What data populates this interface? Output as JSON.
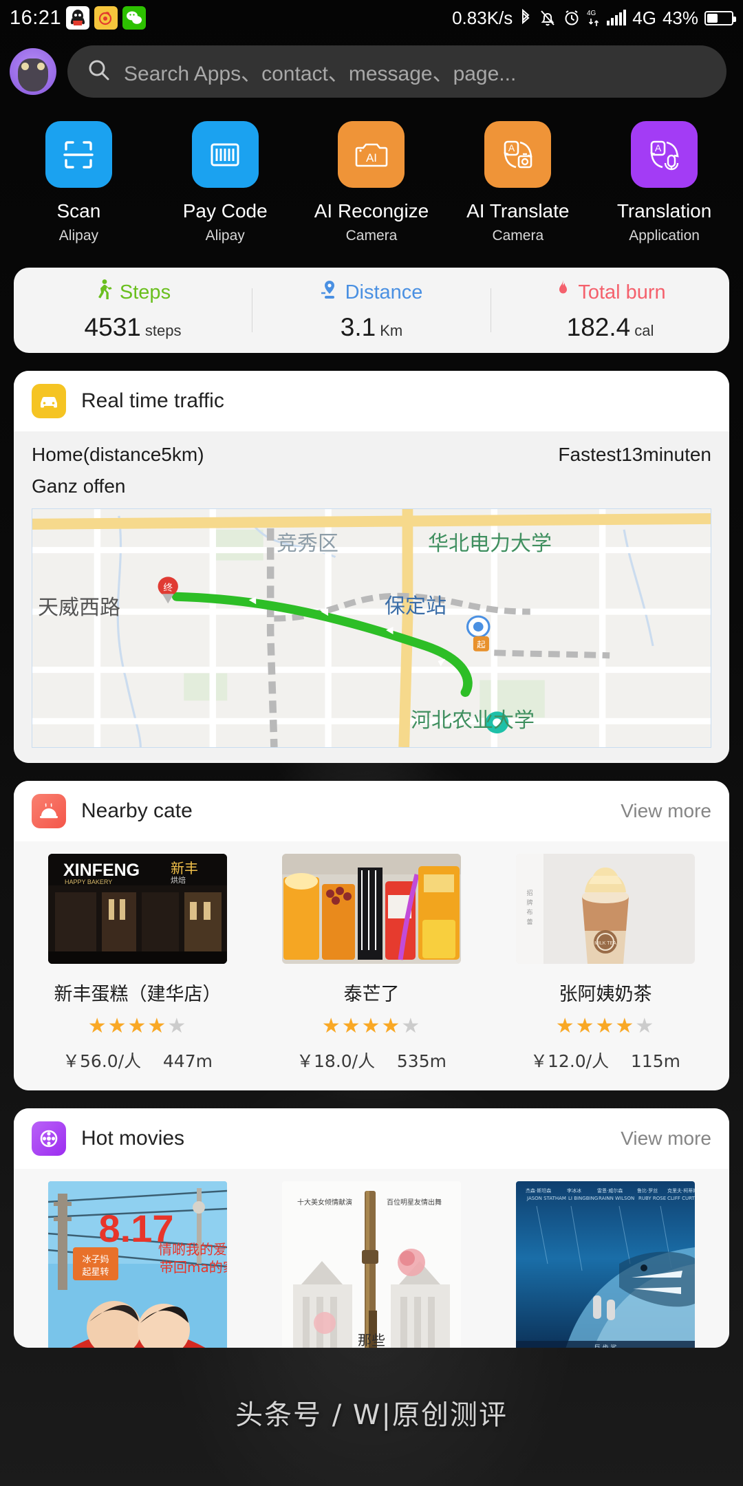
{
  "statusbar": {
    "time": "16:21",
    "apps": [
      "qq-icon",
      "weibo-icon",
      "wechat-icon"
    ],
    "network_speed": "0.83K/s",
    "icons": [
      "bluetooth-icon",
      "mute-bell-icon",
      "alarm-icon",
      "data-transfer-icon",
      "signal-bars-icon"
    ],
    "data_badge": "4G",
    "network_type": "4G",
    "battery_percent": "43%"
  },
  "search": {
    "placeholder": "Search Apps、contact、message、page...",
    "icon": "search-icon",
    "avatar": "user-avatar"
  },
  "shortcuts": [
    {
      "label": "Scan",
      "sub": "Alipay",
      "icon": "scan-frame-icon",
      "color": "#1ba2f0"
    },
    {
      "label": "Pay Code",
      "sub": "Alipay",
      "icon": "barcode-icon",
      "color": "#1ba2f0"
    },
    {
      "label": "AI Recongize",
      "sub": "Camera",
      "icon": "ai-camera-icon",
      "color": "#ef9438"
    },
    {
      "label": "AI Translate",
      "sub": "Camera",
      "icon": "translate-camera-icon",
      "color": "#ef9438"
    },
    {
      "label": "Translation",
      "sub": "Application",
      "icon": "translate-mic-icon",
      "color": "#a33cf5"
    }
  ],
  "fitness": [
    {
      "label": "Steps",
      "icon": "runner-icon",
      "color": "#6abf1e",
      "value": "4531",
      "unit": "steps"
    },
    {
      "label": "Distance",
      "icon": "location-icon",
      "color": "#4a90e2",
      "value": "3.1",
      "unit": "Km"
    },
    {
      "label": "Total burn",
      "icon": "flame-icon",
      "color": "#f4606c",
      "value": "182.4",
      "unit": "cal"
    }
  ],
  "traffic": {
    "title": "Real time traffic",
    "icon": "car-icon",
    "icon_color": "#f5c423",
    "destination": "Home(distance5km)",
    "eta": "Fastest13minuten",
    "status": "Ganz offen",
    "map_labels": [
      {
        "text": "竞秀区",
        "color": "#8d9da8"
      },
      {
        "text": "华北电力大学",
        "color": "#3f8f5f"
      },
      {
        "text": "保定站",
        "color": "#3b6ea8"
      },
      {
        "text": "天威西路",
        "color": "#555555"
      },
      {
        "text": "河北农业大学",
        "color": "#3f8f5f"
      }
    ],
    "route_color": "#2dbe26",
    "marker_end": "终"
  },
  "food": {
    "title": "Nearby cate",
    "icon": "food-dome-icon",
    "icon_color": "#f4675c",
    "more_label": "View more",
    "items": [
      {
        "name": "新丰蛋糕（建华店）",
        "stars_on": 4,
        "stars_off": 1,
        "price": "￥56.0/人",
        "distance": "447m",
        "thumb": "bakery-storefront-photo"
      },
      {
        "name": "泰芒了",
        "stars_on": 4,
        "stars_off": 1,
        "price": "￥18.0/人",
        "distance": "535m",
        "thumb": "mango-drinks-photo"
      },
      {
        "name": "张阿姨奶茶",
        "stars_on": 4,
        "stars_off": 1,
        "price": "￥12.0/人",
        "distance": "115m",
        "thumb": "milk-tea-photo"
      }
    ]
  },
  "movies": {
    "title": "Hot movies",
    "icon": "film-reel-icon",
    "icon_color": "#a33cf5",
    "more_label": "View more",
    "items": [
      {
        "poster": "comedy-couple-poster",
        "badge": "8.17"
      },
      {
        "poster": "white-rose-rifle-poster",
        "badge": ""
      },
      {
        "poster": "blue-shark-poster",
        "badge": ""
      }
    ]
  },
  "watermark": "头条号 / W|原创测评"
}
